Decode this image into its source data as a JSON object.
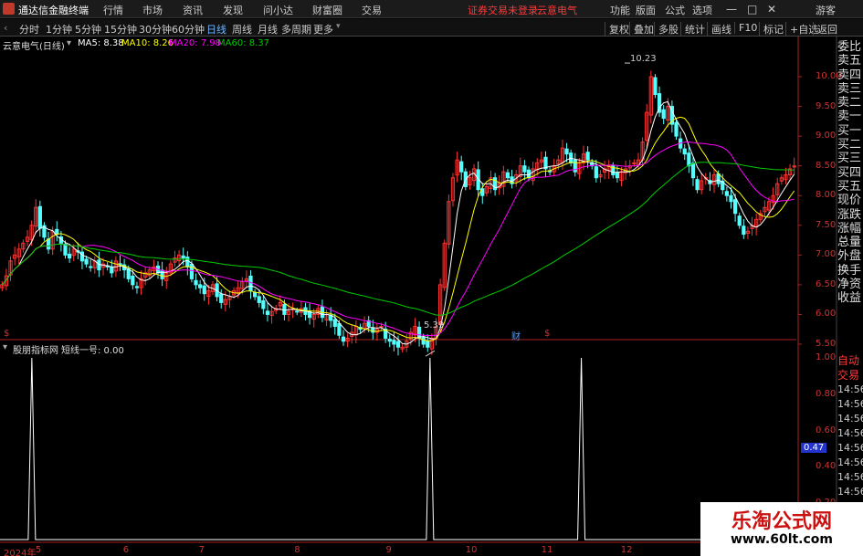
{
  "menu": {
    "app_title": "通达信金融终端",
    "items": [
      "行情",
      "市场",
      "资讯",
      "发现",
      "问小达",
      "财富圈",
      "交易"
    ],
    "status": "证券交易未登录",
    "stock": "云意电气",
    "right_items": [
      "功能",
      "版面",
      "公式",
      "选项"
    ],
    "guest": "游客",
    "ctrl_min": "—",
    "ctrl_max": "□",
    "ctrl_close": "✕"
  },
  "periods": [
    "分时",
    "1分钟",
    "5分钟",
    "15分钟",
    "30分钟",
    "60分钟",
    "日线",
    "周线",
    "月线",
    "多周期",
    "更多"
  ],
  "active_period": "日线",
  "toolbar_right": [
    "复权",
    "叠加",
    "多股",
    "统计",
    "画线",
    "F10",
    "标记",
    "+自选",
    "返回"
  ],
  "info": {
    "title": "云意电气(日线)",
    "ma5": "MA5: 8.38",
    "ma10": "MA10: 8.26",
    "ma20": "MA20: 7.98",
    "ma60": "MA60: 8.37"
  },
  "indicator": {
    "title": "股朋指标网",
    "line": "短线一号: 0.00",
    "current": "0.47"
  },
  "price_axis": [
    "10.00",
    "9.50",
    "9.00",
    "8.50",
    "8.00",
    "7.50",
    "7.00",
    "6.50",
    "6.00",
    "5.50"
  ],
  "ind_axis": [
    "1.00",
    "0.80",
    "0.60",
    "0.40",
    "0.20"
  ],
  "annotations": {
    "high": "10.23",
    "low": "5.39"
  },
  "markers": {
    "s": "$",
    "cai": "财"
  },
  "dates": [
    "2024年",
    "5",
    "6",
    "7",
    "8",
    "9",
    "10",
    "11",
    "12"
  ],
  "sidebar": [
    "委比",
    "卖五",
    "卖四",
    "卖三",
    "卖二",
    "卖一",
    "买一",
    "买二",
    "买三",
    "买四",
    "买五",
    "现价",
    "涨跌",
    "涨幅",
    "总量",
    "外盘",
    "换手",
    "净资",
    "收益"
  ],
  "sidebar2": [
    "自动",
    "交易",
    "14:56",
    "14:56",
    "14:56",
    "14:56",
    "14:56",
    "14:56",
    "14:56",
    "14:56",
    "14:56",
    "14:56"
  ],
  "watermark": {
    "line1": "乐淘公式网",
    "line2": "www.60lt.com"
  },
  "colors": {
    "up": "#ff3232",
    "down": "#54ffff",
    "ma5": "#ffffff",
    "ma10": "#ffff00",
    "ma20": "#ff00ff",
    "ma60": "#00cc00",
    "accent": "#cc3333"
  },
  "chart_data": {
    "type": "candlestick",
    "price_range": [
      5.3,
      10.4
    ],
    "high": 10.23,
    "low": 5.39,
    "closes": [
      6.5,
      6.65,
      6.9,
      7.0,
      7.1,
      7.2,
      7.3,
      7.5,
      7.8,
      7.45,
      7.3,
      7.1,
      7.4,
      7.35,
      7.2,
      7.0,
      6.95,
      7.1,
      7.05,
      6.9,
      6.85,
      6.8,
      6.9,
      6.75,
      6.85,
      6.8,
      6.7,
      6.9,
      6.85,
      6.75,
      6.6,
      6.5,
      6.45,
      6.6,
      6.7,
      6.75,
      6.8,
      6.7,
      6.6,
      6.7,
      6.85,
      6.95,
      7.0,
      6.95,
      6.8,
      6.6,
      6.5,
      6.45,
      6.35,
      6.4,
      6.5,
      6.3,
      6.2,
      6.25,
      6.3,
      6.4,
      6.45,
      6.55,
      6.6,
      6.4,
      6.3,
      6.2,
      6.1,
      6.0,
      6.05,
      6.1,
      6.2,
      6.0,
      6.05,
      6.1,
      6.05,
      6.1,
      6.0,
      5.95,
      6.0,
      6.1,
      5.95,
      6.0,
      5.9,
      5.8,
      5.65,
      5.55,
      5.6,
      5.7,
      5.8,
      5.75,
      5.85,
      5.8,
      5.7,
      5.75,
      5.8,
      5.6,
      5.55,
      5.5,
      5.45,
      5.45,
      5.55,
      5.7,
      5.8,
      5.6,
      5.5,
      5.45,
      5.6,
      5.8,
      6.5,
      7.2,
      7.9,
      8.3,
      8.6,
      8.4,
      8.15,
      8.3,
      8.45,
      8.1,
      8.0,
      8.15,
      8.3,
      8.1,
      8.2,
      8.4,
      8.3,
      8.2,
      8.35,
      8.5,
      8.4,
      8.3,
      8.45,
      8.55,
      8.6,
      8.45,
      8.4,
      8.5,
      8.6,
      8.8,
      8.7,
      8.55,
      8.4,
      8.55,
      8.7,
      8.6,
      8.5,
      8.3,
      8.35,
      8.45,
      8.5,
      8.35,
      8.3,
      8.4,
      8.45,
      8.5,
      8.55,
      8.6,
      8.9,
      9.4,
      10.0,
      9.7,
      9.4,
      9.3,
      9.5,
      9.2,
      9.0,
      8.8,
      8.7,
      8.5,
      8.3,
      8.1,
      8.25,
      8.3,
      8.2,
      8.35,
      8.2,
      8.1,
      8.0,
      7.9,
      7.7,
      7.5,
      7.35,
      7.4,
      7.5,
      7.6,
      7.7,
      7.8,
      7.9,
      8.0,
      8.2,
      8.3,
      8.35,
      8.45,
      8.5
    ]
  },
  "ind_data": {
    "spikes": [
      0.04,
      0.54,
      0.73
    ],
    "range": [
      0,
      1
    ]
  }
}
